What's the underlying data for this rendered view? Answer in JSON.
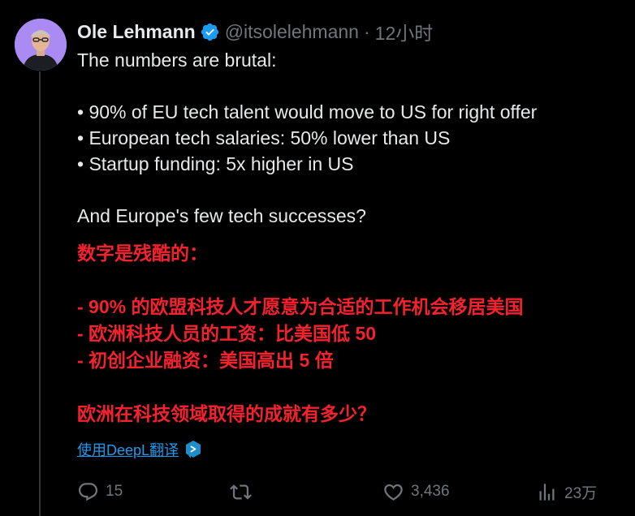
{
  "tweet": {
    "author": {
      "display_name": "Ole Lehmann",
      "handle": "@itsolelehmann",
      "time": "12小时",
      "separator": "·"
    },
    "body_lines": [
      "The numbers are brutal:",
      "",
      "• 90% of EU tech talent would move to US for right offer",
      "• European tech salaries: 50% lower than US",
      "• Startup funding: 5x higher in US",
      "",
      "And Europe's few tech successes?"
    ],
    "translation_lines": [
      "数字是残酷的：",
      "",
      "- 90% 的欧盟科技人才愿意为合适的工作机会移居美国",
      "- 欧洲科技人员的工资：比美国低 50",
      "- 初创企业融资：美国高出 5 倍",
      "",
      "欧洲在科技领域取得的成就有多少？"
    ],
    "translate_label": "使用DeepL翻译",
    "actions": {
      "replies": "15",
      "retweets": "",
      "likes": "3,436",
      "views": "23万"
    }
  },
  "colors": {
    "background": "#000000",
    "text": "#e7e9ea",
    "muted": "#71767b",
    "accent_blue": "#1d9bf0",
    "translation_red": "#f4212e",
    "avatar_bg": "#a98bf3"
  },
  "icons": {
    "verified": "verified-badge-icon",
    "deepl": "deepl-icon",
    "reply": "reply-icon",
    "retweet": "retweet-icon",
    "like": "heart-icon",
    "views": "views-icon"
  }
}
